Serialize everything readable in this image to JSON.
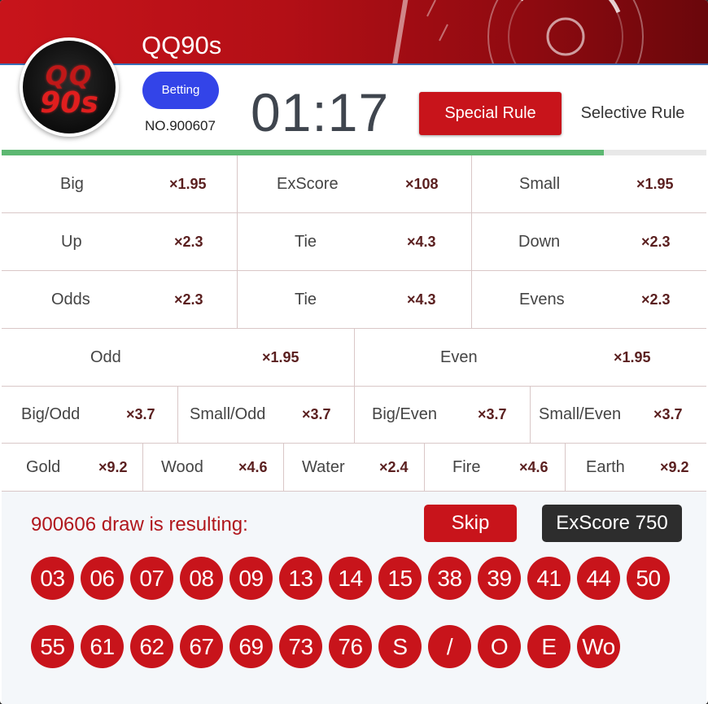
{
  "header": {
    "logo_line1": "QQ",
    "logo_line2": "90s",
    "title": "QQ90s",
    "status_badge": "Betting",
    "draw_number": "NO.900607",
    "countdown": "01:17",
    "special_rule_label": "Special Rule",
    "selective_rule_label": "Selective Rule",
    "countdown_progress": 0.855
  },
  "bets": {
    "row1": [
      {
        "label": "Big",
        "odds": "×1.95"
      },
      {
        "label": "ExScore",
        "odds": "×108"
      },
      {
        "label": "Small",
        "odds": "×1.95"
      }
    ],
    "row2": [
      {
        "label": "Up",
        "odds": "×2.3"
      },
      {
        "label": "Tie",
        "odds": "×4.3"
      },
      {
        "label": "Down",
        "odds": "×2.3"
      }
    ],
    "row3": [
      {
        "label": "Odds",
        "odds": "×2.3"
      },
      {
        "label": "Tie",
        "odds": "×4.3"
      },
      {
        "label": "Evens",
        "odds": "×2.3"
      }
    ],
    "row4": [
      {
        "label": "Odd",
        "odds": "×1.95"
      },
      {
        "label": "Even",
        "odds": "×1.95"
      }
    ],
    "row5": [
      {
        "label": "Big/Odd",
        "odds": "×3.7"
      },
      {
        "label": "Small/Odd",
        "odds": "×3.7"
      },
      {
        "label": "Big/Even",
        "odds": "×3.7"
      },
      {
        "label": "Small/Even",
        "odds": "×3.7"
      }
    ],
    "row6": [
      {
        "label": "Gold",
        "odds": "×9.2"
      },
      {
        "label": "Wood",
        "odds": "×4.6"
      },
      {
        "label": "Water",
        "odds": "×2.4"
      },
      {
        "label": "Fire",
        "odds": "×4.6"
      },
      {
        "label": "Earth",
        "odds": "×9.2"
      }
    ]
  },
  "result": {
    "text": "900606 draw is resulting:",
    "skip_label": "Skip",
    "exscore_label": "ExScore 750",
    "balls": [
      "03",
      "06",
      "07",
      "08",
      "09",
      "13",
      "14",
      "15",
      "38",
      "39",
      "41",
      "44",
      "50",
      "55",
      "61",
      "62",
      "67",
      "69",
      "73",
      "76",
      "S",
      "/",
      "O",
      "E",
      "Wo"
    ]
  },
  "colors": {
    "brand_red": "#c8141b",
    "badge_blue": "#3344e8",
    "progress_green": "#5db872",
    "dark_button": "#2d2d2d"
  }
}
